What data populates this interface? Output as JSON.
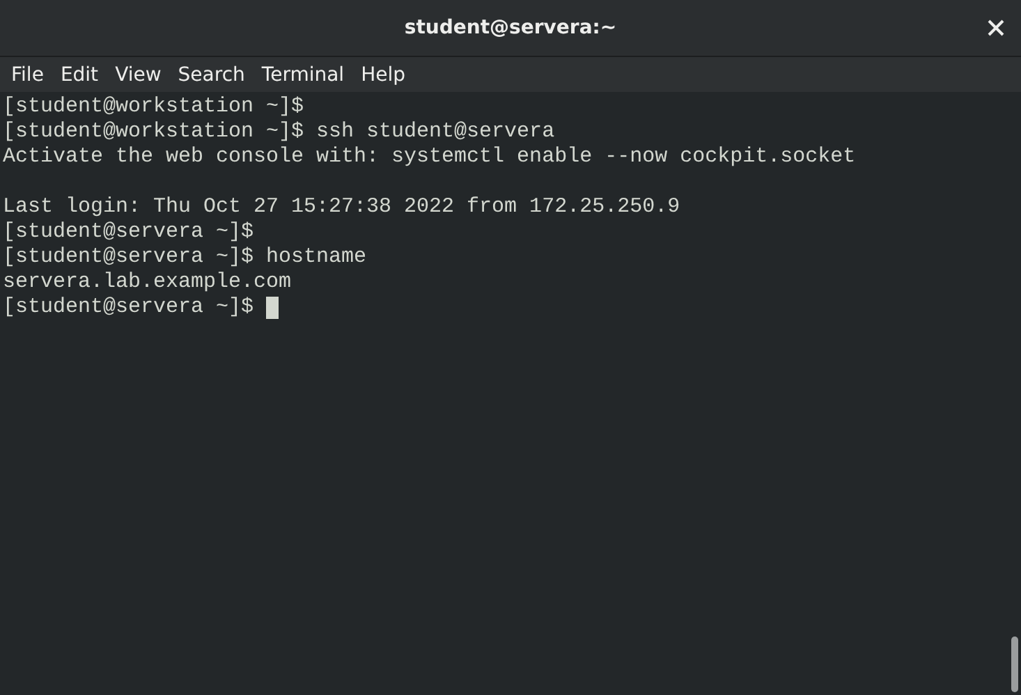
{
  "window": {
    "title": "student@servera:~"
  },
  "menu": [
    {
      "label": "File"
    },
    {
      "label": "Edit"
    },
    {
      "label": "View"
    },
    {
      "label": "Search"
    },
    {
      "label": "Terminal"
    },
    {
      "label": "Help"
    }
  ],
  "terminal": {
    "cursor_visible": true,
    "lines": [
      {
        "kind": "text",
        "text": "[student@workstation ~]$"
      },
      {
        "kind": "text",
        "text": "[student@workstation ~]$ ssh student@servera"
      },
      {
        "kind": "text",
        "text": "Activate the web console with: systemctl enable --now cockpit.socket"
      },
      {
        "kind": "blank"
      },
      {
        "kind": "text",
        "text": "Last login: Thu Oct 27 15:27:38 2022 from 172.25.250.9"
      },
      {
        "kind": "text",
        "text": "[student@servera ~]$"
      },
      {
        "kind": "text",
        "text": "[student@servera ~]$ hostname"
      },
      {
        "kind": "text",
        "text": "servera.lab.example.com"
      },
      {
        "kind": "text",
        "text": "[student@servera ~]$ "
      }
    ]
  }
}
